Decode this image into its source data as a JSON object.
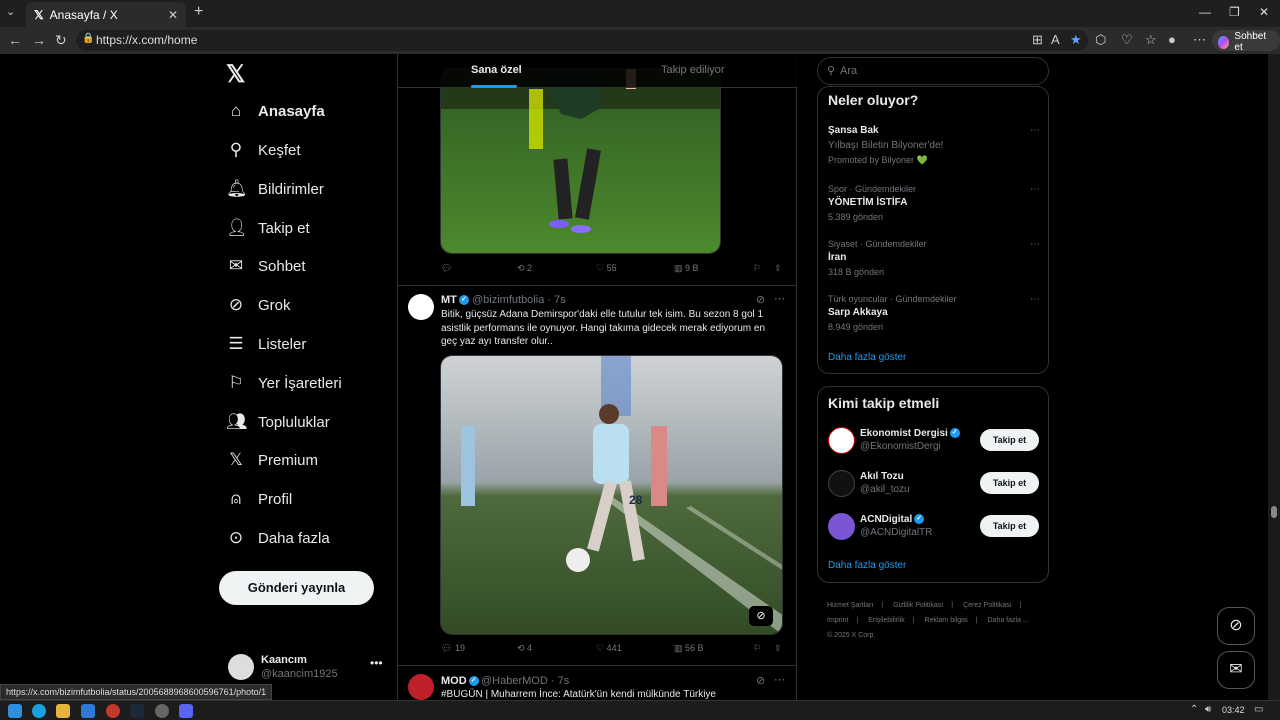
{
  "browser": {
    "tab_title": "Anasayfa / X",
    "tab_icon": "x-icon",
    "url": "https://x.com/home",
    "chat_button": "Sohbet et",
    "status_url": "https://x.com/bizimfutbolia/status/2005688968600596761/photo/1"
  },
  "nav": {
    "items": [
      {
        "label": "Anasayfa",
        "icon": "home-icon",
        "active": true
      },
      {
        "label": "Keşfet",
        "icon": "search-icon"
      },
      {
        "label": "Bildirimler",
        "icon": "bell-icon"
      },
      {
        "label": "Takip et",
        "icon": "follow-icon"
      },
      {
        "label": "Sohbet",
        "icon": "mail-icon"
      },
      {
        "label": "Grok",
        "icon": "grok-icon"
      },
      {
        "label": "Listeler",
        "icon": "list-icon"
      },
      {
        "label": "Yer İşaretleri",
        "icon": "bookmark-icon"
      },
      {
        "label": "Topluluklar",
        "icon": "communities-icon"
      },
      {
        "label": "Premium",
        "icon": "x-icon"
      },
      {
        "label": "Profil",
        "icon": "profile-icon"
      },
      {
        "label": "Daha fazla",
        "icon": "more-icon"
      }
    ],
    "post_button": "Gönderi yayınla",
    "user": {
      "name": "Kaancım",
      "handle": "@kaancim1925"
    }
  },
  "timeline": {
    "tabs": [
      "Sana özel",
      "Takip ediliyor"
    ],
    "tweets": [
      {
        "actions": {
          "replies": "",
          "reposts": "2",
          "likes": "55",
          "views": "9 B"
        }
      },
      {
        "name": "MT",
        "handle": "@bizimfutbolia",
        "time": "· 7s",
        "text_lines": [
          "Bitik, güçsüz Adana Demirspor'daki elle tutulur tek isim. Bu sezon 8 gol 1",
          "asistlik performans ile oynuyor. Hangi takıma gidecek merak ediyorum en",
          "geç yaz ayı transfer olur.."
        ],
        "actions": {
          "replies": "19",
          "reposts": "4",
          "likes": "441",
          "views": "56 B"
        },
        "player_number": "28"
      },
      {
        "name": "MOD",
        "handle": "@HaberMOD",
        "time": "· 7s",
        "text": "#BUGÜN | Muharrem İnce: Atatürk'ün kendi mülkünde Türkiye"
      }
    ]
  },
  "sidebar": {
    "search_placeholder": "Ara",
    "trends_title": "Neler oluyor?",
    "trends": [
      {
        "category": "",
        "title": "Şansa Bak",
        "sub": "Yılbaşı Biletin Bilyoner'de!",
        "count": "Promoted by Bilyoner 💚"
      },
      {
        "category": "Spor · Gündemdekiler",
        "title": "YÖNETİM İSTİFA",
        "count": "5.389 gönderi"
      },
      {
        "category": "Siyaset · Gündemdekiler",
        "title": "İran",
        "count": "318 B gönderi"
      },
      {
        "category": "Türk oyuncular · Gündemdekiler",
        "title": "Sarp Akkaya",
        "count": "8.949 gönderi"
      }
    ],
    "show_more": "Daha fazla göster",
    "who_title": "Kimi takip etmeli",
    "who": [
      {
        "name": "Ekonomist Dergisi",
        "handle": "@EkonomistDergi",
        "verified": true,
        "color": "#ffffff"
      },
      {
        "name": "Akıl Tozu",
        "handle": "@akil_tozu",
        "verified": false,
        "color": "#111111"
      },
      {
        "name": "ACNDigital",
        "handle": "@ACNDigitalTR",
        "verified": true,
        "color": "#7a56d6"
      }
    ],
    "follow_label": "Takip et",
    "footer": [
      "Hizmet Şartları",
      "|",
      "Gizlilik Politikası",
      "|",
      "Çerez Politikası",
      "|",
      "Imprint",
      "|",
      "Erişilebilirlik",
      "|",
      "Reklam bilgisi",
      "|",
      "Daha fazla ...",
      "© 2025 X Corp."
    ]
  },
  "taskbar": {
    "clock": "03:42"
  },
  "colors": {
    "accent": "#1d9bf0",
    "background": "#000000",
    "muted": "#71767b"
  }
}
